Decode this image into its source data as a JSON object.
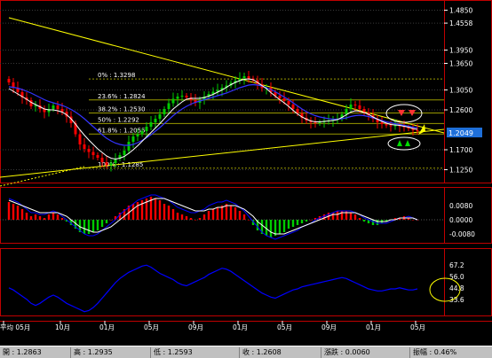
{
  "colors": {
    "background": "#000000",
    "panel_border": "#c00000",
    "up_candle": "#00cc00",
    "down_candle": "#ff0000",
    "ma_short": "#ffffff",
    "ma_long": "#3333ff",
    "trendline": "#ffff00",
    "fib_line": "#999900",
    "osc_line": "#0000ff",
    "macd_signal": "#ffffff",
    "macd_line": "#0000ff"
  },
  "chart_data": [
    {
      "type": "candlestick",
      "panel": "price",
      "ylim": [
        1.1,
        1.5
      ],
      "yticks": [
        "1.4850",
        "1.4558",
        "1.3950",
        "1.3650",
        "1.3050",
        "1.2600",
        "1.2049",
        "1.1700",
        "1.1250"
      ],
      "last_price": "1.2049",
      "x_labels": [
        "平均 05月",
        "10月",
        "01月",
        "05月",
        "09月",
        "01月",
        "05月",
        "09月",
        "01月",
        "05月"
      ],
      "fib_levels": [
        {
          "label": "0%",
          "value": "1.3298"
        },
        {
          "label": "23.6%",
          "value": "1.2824"
        },
        {
          "label": "38.2%",
          "value": "1.2530"
        },
        {
          "label": "50%",
          "value": "1.2292"
        },
        {
          "label": "61.8%",
          "value": "1.2055"
        },
        {
          "label": "100%",
          "value": "1.1285"
        }
      ],
      "close": [
        1.322,
        1.31,
        1.3,
        1.288,
        1.282,
        1.268,
        1.27,
        1.262,
        1.255,
        1.262,
        1.27,
        1.262,
        1.256,
        1.245,
        1.23,
        1.205,
        1.182,
        1.172,
        1.165,
        1.158,
        1.152,
        1.142,
        1.135,
        1.14,
        1.15,
        1.158,
        1.168,
        1.188,
        1.2,
        1.205,
        1.212,
        1.222,
        1.232,
        1.24,
        1.25,
        1.262,
        1.275,
        1.285,
        1.29,
        1.292,
        1.288,
        1.282,
        1.276,
        1.282,
        1.29,
        1.296,
        1.301,
        1.305,
        1.31,
        1.315,
        1.321,
        1.326,
        1.331,
        1.336,
        1.331,
        1.327,
        1.318,
        1.309,
        1.31,
        1.3,
        1.292,
        1.286,
        1.28,
        1.272,
        1.262,
        1.252,
        1.242,
        1.236,
        1.232,
        1.23,
        1.232,
        1.235,
        1.236,
        1.238,
        1.24,
        1.25,
        1.262,
        1.272,
        1.27,
        1.262,
        1.254,
        1.248,
        1.24,
        1.232,
        1.228,
        1.225,
        1.223,
        1.225,
        1.224,
        1.221,
        1.218,
        1.214,
        1.212
      ],
      "ma_short": [
        1.308,
        1.302,
        1.296,
        1.29,
        1.284,
        1.277,
        1.272,
        1.267,
        1.262,
        1.26,
        1.26,
        1.258,
        1.255,
        1.249,
        1.24,
        1.228,
        1.215,
        1.203,
        1.192,
        1.182,
        1.172,
        1.164,
        1.156,
        1.151,
        1.149,
        1.151,
        1.155,
        1.162,
        1.17,
        1.179,
        1.189,
        1.199,
        1.209,
        1.219,
        1.229,
        1.24,
        1.251,
        1.262,
        1.27,
        1.278,
        1.284,
        1.286,
        1.286,
        1.286,
        1.288,
        1.291,
        1.295,
        1.3,
        1.305,
        1.311,
        1.317,
        1.322,
        1.326,
        1.329,
        1.33,
        1.328,
        1.322,
        1.315,
        1.308,
        1.299,
        1.291,
        1.283,
        1.276,
        1.268,
        1.259,
        1.251,
        1.244,
        1.239,
        1.235,
        1.233,
        1.233,
        1.234,
        1.235,
        1.236,
        1.238,
        1.243,
        1.249,
        1.255,
        1.258,
        1.257,
        1.254,
        1.25,
        1.244,
        1.239,
        1.234,
        1.23,
        1.227,
        1.226,
        1.225,
        1.223,
        1.221,
        1.218,
        1.216
      ],
      "ma_long": [
        1.312,
        1.311,
        1.309,
        1.306,
        1.302,
        1.298,
        1.293,
        1.288,
        1.283,
        1.279,
        1.276,
        1.273,
        1.27,
        1.266,
        1.261,
        1.255,
        1.248,
        1.24,
        1.231,
        1.222,
        1.213,
        1.204,
        1.196,
        1.19,
        1.185,
        1.182,
        1.18,
        1.18,
        1.182,
        1.186,
        1.191,
        1.197,
        1.204,
        1.212,
        1.22,
        1.229,
        1.238,
        1.247,
        1.255,
        1.262,
        1.268,
        1.273,
        1.277,
        1.28,
        1.283,
        1.286,
        1.289,
        1.292,
        1.295,
        1.298,
        1.302,
        1.306,
        1.31,
        1.313,
        1.316,
        1.317,
        1.316,
        1.314,
        1.31,
        1.306,
        1.301,
        1.295,
        1.289,
        1.283,
        1.276,
        1.269,
        1.262,
        1.256,
        1.251,
        1.247,
        1.244,
        1.242,
        1.24,
        1.239,
        1.239,
        1.24,
        1.242,
        1.245,
        1.247,
        1.248,
        1.247,
        1.245,
        1.242,
        1.239,
        1.236,
        1.233,
        1.231,
        1.229,
        1.227,
        1.225,
        1.223,
        1.221,
        1.22
      ]
    },
    {
      "type": "bar",
      "panel": "macd",
      "ylim": [
        -0.012,
        0.016
      ],
      "yticks": [
        "0.0080",
        "0.0000",
        "-0.0080"
      ],
      "histogram": [
        0.01,
        0.009,
        0.008,
        0.006,
        0.004,
        0.002,
        0.003,
        0.002,
        0.001,
        0.003,
        0.004,
        0.003,
        0.001,
        -0.001,
        -0.003,
        -0.005,
        -0.007,
        -0.008,
        -0.008,
        -0.007,
        -0.006,
        -0.004,
        -0.002,
        0.0,
        0.002,
        0.004,
        0.006,
        0.008,
        0.009,
        0.01,
        0.011,
        0.012,
        0.013,
        0.012,
        0.011,
        0.009,
        0.008,
        0.006,
        0.004,
        0.003,
        0.002,
        0.001,
        0.0,
        0.001,
        0.003,
        0.005,
        0.006,
        0.007,
        0.008,
        0.009,
        0.008,
        0.007,
        0.005,
        0.003,
        0.0,
        -0.003,
        -0.006,
        -0.008,
        -0.009,
        -0.01,
        -0.009,
        -0.008,
        -0.007,
        -0.005,
        -0.004,
        -0.003,
        -0.002,
        -0.001,
        0.0,
        0.001,
        0.002,
        0.003,
        0.004,
        0.004,
        0.005,
        0.005,
        0.005,
        0.004,
        0.003,
        0.001,
        -0.001,
        -0.002,
        -0.003,
        -0.003,
        -0.002,
        -0.001,
        0.0,
        0.001,
        0.001,
        0.002,
        0.001,
        0.0,
        0.0
      ],
      "signal": [
        0.011,
        0.01,
        0.009,
        0.008,
        0.007,
        0.006,
        0.005,
        0.004,
        0.004,
        0.004,
        0.004,
        0.004,
        0.003,
        0.002,
        0.0,
        -0.002,
        -0.004,
        -0.005,
        -0.006,
        -0.007,
        -0.007,
        -0.006,
        -0.005,
        -0.004,
        -0.002,
        0.0,
        0.002,
        0.004,
        0.006,
        0.008,
        0.009,
        0.01,
        0.011,
        0.012,
        0.012,
        0.012,
        0.011,
        0.01,
        0.009,
        0.008,
        0.007,
        0.006,
        0.005,
        0.005,
        0.005,
        0.006,
        0.006,
        0.007,
        0.007,
        0.008,
        0.008,
        0.008,
        0.007,
        0.006,
        0.004,
        0.002,
        -0.001,
        -0.003,
        -0.005,
        -0.007,
        -0.008,
        -0.008,
        -0.008,
        -0.007,
        -0.006,
        -0.005,
        -0.004,
        -0.003,
        -0.002,
        -0.001,
        0.0,
        0.001,
        0.002,
        0.003,
        0.003,
        0.004,
        0.004,
        0.004,
        0.004,
        0.003,
        0.002,
        0.001,
        0.0,
        -0.001,
        -0.001,
        -0.001,
        0.0,
        0.0,
        0.001,
        0.001,
        0.001,
        0.001,
        0.0
      ],
      "macd": [
        0.012,
        0.011,
        0.01,
        0.008,
        0.006,
        0.004,
        0.004,
        0.003,
        0.003,
        0.004,
        0.005,
        0.004,
        0.002,
        0.0,
        -0.002,
        -0.004,
        -0.006,
        -0.008,
        -0.009,
        -0.009,
        -0.008,
        -0.006,
        -0.004,
        -0.002,
        0.0,
        0.003,
        0.005,
        0.007,
        0.009,
        0.011,
        0.012,
        0.013,
        0.014,
        0.014,
        0.013,
        0.012,
        0.011,
        0.009,
        0.007,
        0.006,
        0.005,
        0.004,
        0.004,
        0.005,
        0.006,
        0.008,
        0.009,
        0.01,
        0.01,
        0.011,
        0.01,
        0.009,
        0.007,
        0.005,
        0.002,
        -0.001,
        -0.004,
        -0.007,
        -0.009,
        -0.01,
        -0.011,
        -0.01,
        -0.009,
        -0.008,
        -0.007,
        -0.006,
        -0.004,
        -0.003,
        -0.002,
        0.0,
        0.001,
        0.002,
        0.003,
        0.004,
        0.005,
        0.005,
        0.005,
        0.005,
        0.004,
        0.003,
        0.001,
        0.0,
        -0.001,
        -0.002,
        -0.002,
        -0.002,
        -0.001,
        0.0,
        0.001,
        0.001,
        0.002,
        0.001,
        0.0
      ]
    },
    {
      "type": "line",
      "panel": "oscillator",
      "ylim": [
        20,
        80
      ],
      "yticks": [
        "67.2",
        "56.0",
        "44.8",
        "33.6"
      ],
      "values": [
        45,
        43,
        40,
        37,
        34,
        30,
        28,
        30,
        33,
        36,
        38,
        36,
        33,
        30,
        28,
        26,
        24,
        22,
        23,
        26,
        30,
        35,
        40,
        45,
        50,
        54,
        57,
        60,
        62,
        64,
        66,
        67,
        65,
        62,
        59,
        57,
        55,
        53,
        50,
        48,
        47,
        49,
        51,
        53,
        55,
        58,
        60,
        62,
        64,
        63,
        61,
        58,
        55,
        52,
        49,
        46,
        43,
        40,
        38,
        36,
        35,
        37,
        39,
        41,
        43,
        44,
        46,
        47,
        48,
        49,
        50,
        51,
        52,
        53,
        54,
        55,
        54,
        52,
        50,
        48,
        46,
        44,
        43,
        42,
        42,
        43,
        44,
        44,
        45,
        44,
        43,
        43,
        44
      ]
    }
  ],
  "status_bar": [
    "開 : 1.2863",
    "高 : 1.2935",
    "低 : 1.2593",
    "收 : 1.2608",
    "漲跌 : 0.0060",
    "振幅 : 0.46%"
  ]
}
